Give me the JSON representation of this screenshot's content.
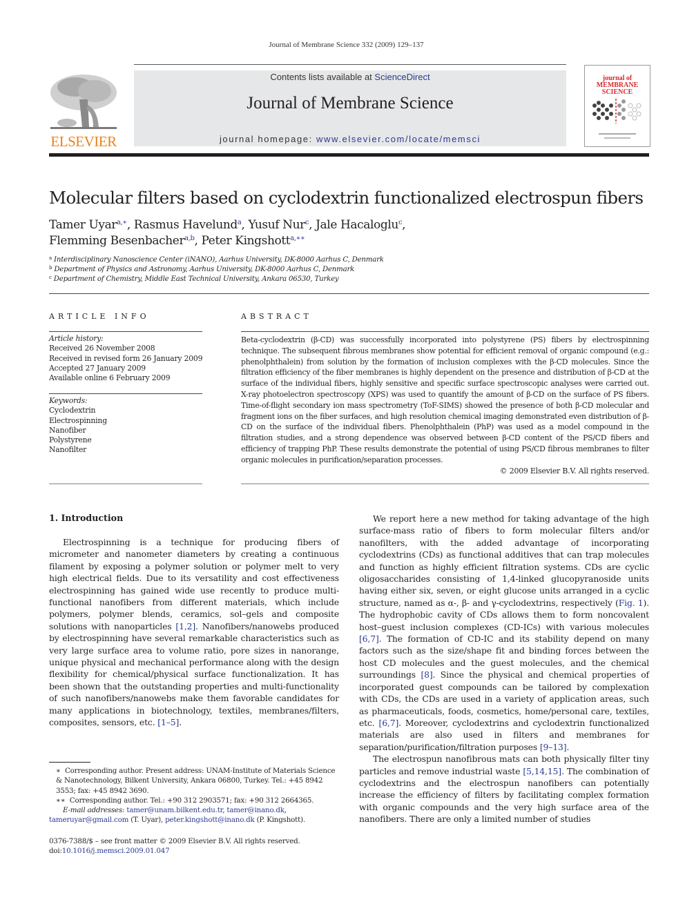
{
  "running_header": "Journal of Membrane Science 332 (2009) 129–137",
  "masthead": {
    "publisher_logo_text": "ELSEVIER",
    "contents_prefix": "Contents lists available at ",
    "contents_link": "ScienceDirect",
    "journal_title": "Journal of Membrane Science",
    "homepage_prefix": "journal homepage: ",
    "homepage_link": "www.elsevier.com/locate/memsci",
    "cover_title_lines": [
      "journal of",
      "MEMBRANE",
      "SCIENCE"
    ],
    "colors": {
      "elsevier_orange": "#e8821e",
      "link_blue": "#2a3a8f",
      "cover_red": "#d6282e",
      "banner_grey": "#e6e7e8"
    }
  },
  "article": {
    "title": "Molecular filters based on cyclodextrin functionalized electrospun fibers",
    "authors": [
      {
        "name": "Tamer Uyar",
        "sup": "a,∗",
        "sep": ", "
      },
      {
        "name": "Rasmus Havelund",
        "sup": "a",
        "sep": ", "
      },
      {
        "name": "Yusuf Nur",
        "sup": "c",
        "sep": ", "
      },
      {
        "name": "Jale Hacaloglu",
        "sup": "c",
        "sep": ","
      },
      {
        "name": "Flemming Besenbacher",
        "sup": "a,b",
        "sep": ", "
      },
      {
        "name": "Peter Kingshott",
        "sup": "a,∗∗",
        "sep": ""
      }
    ],
    "affiliations": [
      {
        "key": "a",
        "text": "Interdisciplinary Nanoscience Center (iNANO), Aarhus University, DK-8000 Aarhus C, Denmark"
      },
      {
        "key": "b",
        "text": "Department of Physics and Astronomy, Aarhus University, DK-8000 Aarhus C, Denmark"
      },
      {
        "key": "c",
        "text": "Department of Chemistry, Middle East Technical University, Ankara 06530, Turkey"
      }
    ]
  },
  "article_info": {
    "label": "ARTICLE INFO",
    "history_heading": "Article history:",
    "history": [
      "Received 26 November 2008",
      "Received in revised form 26 January 2009",
      "Accepted 27 January 2009",
      "Available online 6 February 2009"
    ],
    "keywords_heading": "Keywords:",
    "keywords": [
      "Cyclodextrin",
      "Electrospinning",
      "Nanofiber",
      "Polystyrene",
      "Nanofilter"
    ]
  },
  "abstract": {
    "label": "ABSTRACT",
    "text": "Beta-cyclodextrin (β-CD) was successfully incorporated into polystyrene (PS) fibers by electrospinning technique. The subsequent fibrous membranes show potential for efficient removal of organic compound (e.g.: phenolphthalein) from solution by the formation of inclusion complexes with the β-CD molecules. Since the filtration efficiency of the fiber membranes is highly dependent on the presence and distribution of β-CD at the surface of the individual fibers, highly sensitive and specific surface spectroscopic analyses were carried out. X-ray photoelectron spectroscopy (XPS) was used to quantify the amount of β-CD on the surface of PS fibers. Time-of-flight secondary ion mass spectrometry (ToF-SIMS) showed the presence of both β-CD molecular and fragment ions on the fiber surfaces, and high resolution chemical imaging demonstrated even distribution of β-CD on the surface of the individual fibers. Phenolphthalein (PhP) was used as a model compound in the filtration studies, and a strong dependence was observed between β-CD content of the PS/CD fibers and efficiency of trapping PhP. These results demonstrate the potential of using PS/CD fibrous membranes to filter organic molecules in purification/separation processes.",
    "copyright": "© 2009 Elsevier B.V. All rights reserved."
  },
  "body": {
    "section_heading": "1.  Introduction",
    "left_paragraphs": [
      [
        {
          "t": "Electrospinning is a technique for producing fibers of micrometer and nanometer diameters by creating a continuous filament by exposing a polymer solution or polymer melt to very high electrical fields. Due to its versatility and cost effectiveness electrospinning has gained wide use recently to produce multi-functional nanofibers from different materials, which include polymers, polymer blends, ceramics, sol–gels and composite solutions with nanoparticles "
        },
        {
          "ref": "[1,2]"
        },
        {
          "t": ". Nanofibers/nanowebs produced by electrospinning have several remarkable characteristics such as very large surface area to volume ratio, pore sizes in nanorange, unique physical and mechanical performance along with the design flexibility for chemical/physical surface functionalization. It has been shown that the outstanding properties and multi-functionality of such nanofibers/nanowebs make them favorable candidates for many applications in biotechnology, textiles, membranes/filters, composites, sensors, etc. "
        },
        {
          "ref": "[1–5]"
        },
        {
          "t": "."
        }
      ]
    ],
    "right_paragraphs": [
      [
        {
          "t": "We report here a new method for taking advantage of the high surface-mass ratio of fibers to form molecular filters and/or nanofilters, with the added advantage of incorporating cyclodextrins (CDs) as functional additives that can trap molecules and function as highly efficient filtration systems. CDs are cyclic oligosaccharides consisting of 1,4-linked glucopyranoside units having either six, seven, or eight glucose units arranged in a cyclic structure, named as α-, β- and γ-cyclodextrins, respectively ("
        },
        {
          "ref": "Fig. 1"
        },
        {
          "t": "). The hydrophobic cavity of CDs allows them to form noncovalent host–guest inclusion complexes (CD-ICs) with various molecules "
        },
        {
          "ref": "[6,7]"
        },
        {
          "t": ". The formation of CD-IC and its stability depend on many factors such as the size/shape fit and binding forces between the host CD molecules and the guest molecules, and the chemical surroundings "
        },
        {
          "ref": "[8]"
        },
        {
          "t": ". Since the physical and chemical properties of incorporated guest compounds can be tailored by complexation with CDs, the CDs are used in a variety of application areas, such as pharmaceuticals, foods, cosmetics, home/personal care, textiles, etc. "
        },
        {
          "ref": "[6,7]"
        },
        {
          "t": ". Moreover, cyclodextrins and cyclodextrin functionalized materials are also used in filters and membranes for separation/purification/filtration purposes "
        },
        {
          "ref": "[9–13]"
        },
        {
          "t": "."
        }
      ],
      [
        {
          "t": "The electrospun nanofibrous mats can both physically filter tiny particles and remove industrial waste "
        },
        {
          "ref": "[5,14,15]"
        },
        {
          "t": ". The combination of cyclodextrins and the electrospun nanofibers can potentially increase the efficiency of filters by facilitating complex formation with organic compounds and the very high surface area of the nanofibers. There are only a limited number of studies"
        }
      ]
    ]
  },
  "footnotes": {
    "fn1_mark": "∗",
    "fn1_text": "Corresponding author. Present address: UNAM-Institute of Materials Science & Nanotechnology, Bilkent University, Ankara 06800, Turkey. Tel.: +45 8942 3553; fax: +45 8942 3690.",
    "fn2_mark": "∗∗",
    "fn2_text": "Corresponding author. Tel.: +90 312 2903571; fax: +90 312 2664365.",
    "email_label": "E-mail addresses:",
    "emails": [
      {
        "addr": "tamer@unam.bilkent.edu.tr",
        "after": ", "
      },
      {
        "addr": "tamer@inano.dk",
        "after": ","
      },
      {
        "addr": "tameruyar@gmail.com",
        "after": " (T. Uyar), "
      },
      {
        "addr": "peter.kingshott@inano.dk",
        "after": " (P. Kingshott)."
      }
    ],
    "issn_line": "0376-7388/$ – see front matter © 2009 Elsevier B.V. All rights reserved.",
    "doi_prefix": "doi:",
    "doi": "10.1016/j.memsci.2009.01.047"
  }
}
